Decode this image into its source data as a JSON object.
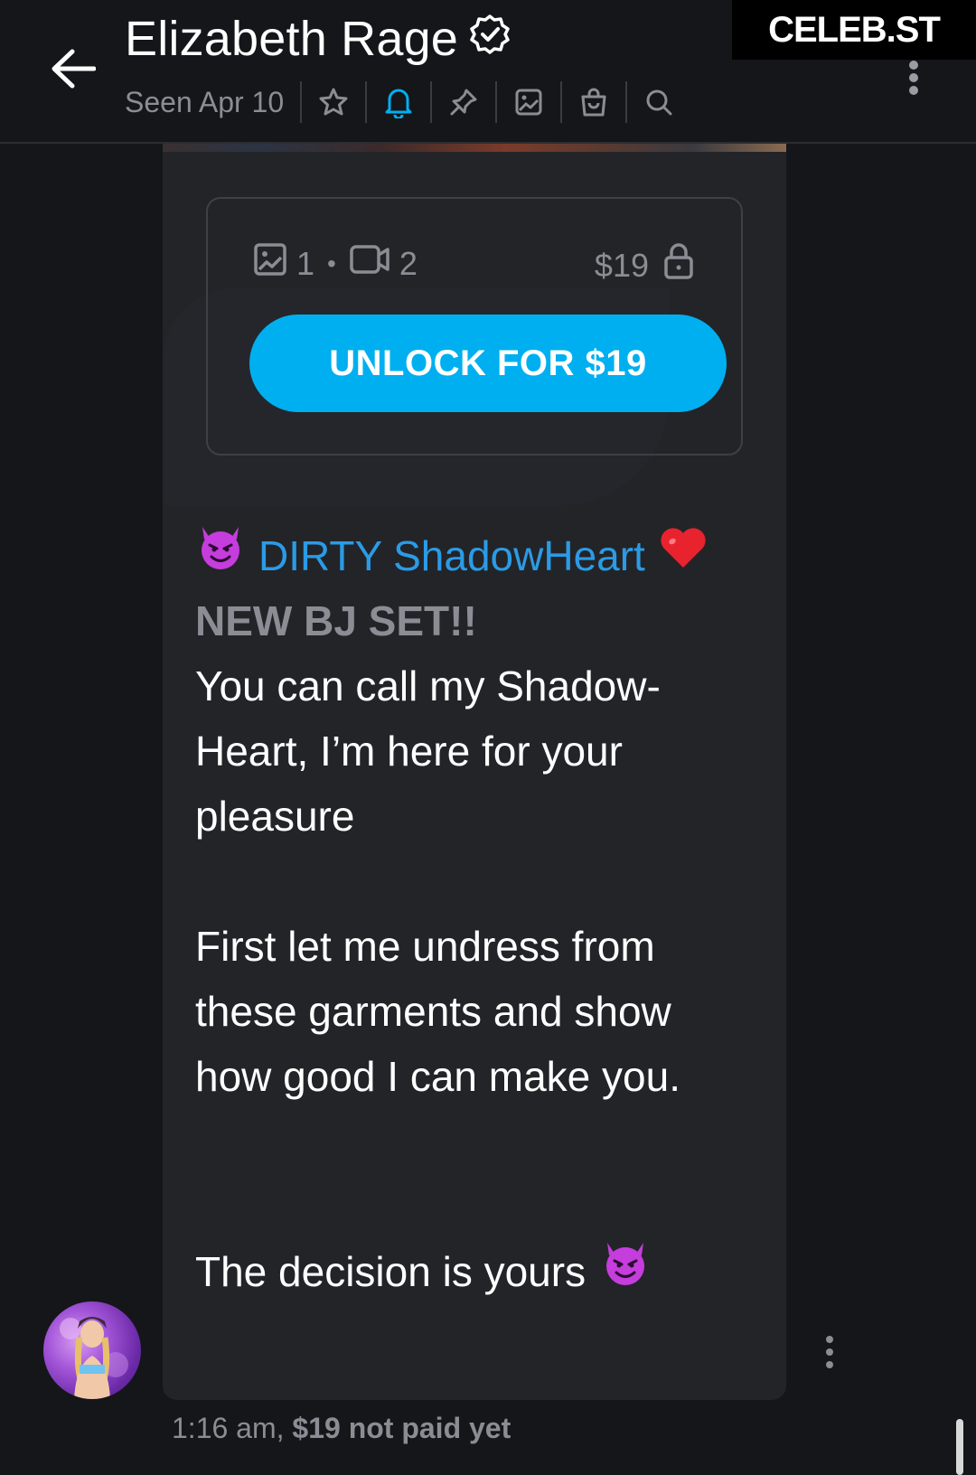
{
  "header": {
    "title": "Elizabeth Rage",
    "seen": "Seen Apr 10",
    "icons": [
      "star-icon",
      "bell-icon",
      "pin-icon",
      "image-icon",
      "bag-icon",
      "search-icon"
    ]
  },
  "watermark": "CELEB.ST",
  "locked_post": {
    "images_count": "1",
    "dot": "•",
    "videos_count": "2",
    "price": "$19",
    "unlock_label": "UNLOCK FOR $19"
  },
  "message": {
    "headline": "DIRTY ShadowHeart",
    "subheadline": "NEW BJ SET!!",
    "para1": "You can call my Shadow-Heart, I’m here for your pleasure",
    "para2": "First let me undress from these garments and show how good I can make you.",
    "closing": "The decision is yours"
  },
  "meta": {
    "time": "1:16 am,",
    "status": "$19 not paid yet"
  },
  "colors": {
    "accent": "#00aff0",
    "link": "#2b9be6",
    "muted": "#8a8d94",
    "background": "#151619",
    "bubble": "#232428"
  }
}
